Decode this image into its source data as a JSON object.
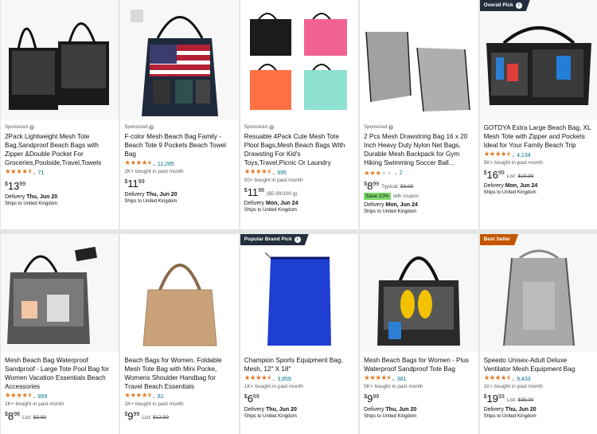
{
  "colors": {
    "overall_pick": "#232f3e",
    "brand_pick": "#232f3e",
    "best_seller": "#c45500",
    "star": "#de7921",
    "link": "#007185",
    "save": "#7fda69"
  },
  "products": [
    {
      "sponsored": "Sponsored",
      "title": "2Pack Lightweight Mesh Tote Bag,Sandproof Beach Bags with Zipper &Double Pocket For Groceries,Poolside,Travel,Towels",
      "rating": 4.5,
      "count": "71",
      "bought": "",
      "cur": "$",
      "whole": "13",
      "frac": "99",
      "delivery_pre": "Delivery ",
      "delivery_date": "Thu, Jun 20",
      "ships": "Ships to United Kingdom",
      "image": "tote-pair-black"
    },
    {
      "sponsored": "Sponsored",
      "title": "F-color Mesh Beach Bag Family - Beach Tote 9 Pockets Beach Towel Bag",
      "rating": 4.5,
      "count": "11,285",
      "bought": "2K+ bought in past month",
      "cur": "$",
      "whole": "11",
      "frac": "99",
      "delivery_pre": "Delivery ",
      "delivery_date": "Thu, Jun 20",
      "ships": "Ships to United Kingdom",
      "image": "flag-tote"
    },
    {
      "sponsored": "Sponsored",
      "title": "Resuable 4Pack Cute Mesh Tote Plool Bags,Mesh Beach Bags With Drawsting For Kid's Toys,Travel,Picnic Or Laundry",
      "rating": 4.5,
      "count": "695",
      "bought": "50+ bought in past month",
      "cur": "$",
      "whole": "11",
      "frac": "98",
      "unit": "($5.99/100 g)",
      "delivery_pre": "Delivery ",
      "delivery_date": "Mon, Jun 24",
      "ships": "Ships to United Kingdom",
      "image": "four-pack"
    },
    {
      "sponsored": "Sponsored",
      "title": "2 Pcs Mesh Drawstring Bag 16 x 20 Inch Heavy Duty Nylon Net Bags, Durable Mesh Backpack for Gym Hiking Swimming Soccer Ball...",
      "rating": 3.0,
      "count": "2",
      "bought": "",
      "cur": "$",
      "whole": "8",
      "frac": "99",
      "typical_label": "Typical: ",
      "typical_price": "$9.99",
      "save": "Save 10%",
      "coupon": "with coupon",
      "delivery_pre": "Delivery ",
      "delivery_date": "Mon, Jun 24",
      "ships": "Ships to United Kingdom",
      "image": "drawstring-pair"
    },
    {
      "badge": "Overall Pick",
      "title": "GOTDYA Extra Large Beach Bag, XL Mesh Tote with Zipper and Pockets Ideal for Your Family Beach Trip",
      "rating": 4.5,
      "count": "4,134",
      "bought": "5K+ bought in past month",
      "cur": "$",
      "whole": "16",
      "frac": "99",
      "list_label": "List: ",
      "list_price": "$19.99",
      "delivery_pre": "Delivery ",
      "delivery_date": "Mon, Jun 24",
      "ships": "Ships to United Kingdom",
      "image": "xl-tote"
    },
    {
      "title": "Mesh Beach Bag Waterproof Sandproof - Large Tote Pool Bag for Women Vacation Essentials Beach Accessories",
      "rating": 4.5,
      "count": "899",
      "bought": "2K+ bought in past month",
      "cur": "$",
      "whole": "8",
      "frac": "98",
      "list_label": "List: ",
      "list_price": "$9.99",
      "image": "grey-tote"
    },
    {
      "title": "Beach Bags for Women, Foldable Mesh Tote Bag with Mini Pocke, Womens Shoulder Handbag for Travel Beach Essentials",
      "rating": 4.5,
      "count": "81",
      "bought": "1K+ bought in past month",
      "cur": "$",
      "whole": "9",
      "frac": "99",
      "list_label": "List: ",
      "list_price": "$12.99",
      "image": "tan-tote"
    },
    {
      "badge": "Popular Brand Pick",
      "title": "Champion Sports Equipment Bag, Mesh, 12\" X 18\"",
      "rating": 4.5,
      "count": "3,859",
      "bought": "1K+ bought in past month",
      "cur": "$",
      "whole": "6",
      "frac": "99",
      "delivery_pre": "Delivery ",
      "delivery_date": "Thu, Jun 20",
      "ships": "Ships to United Kingdom",
      "image": "blue-net"
    },
    {
      "title": "Mesh Beach Bags for Women - Plus Waterproof Sandproof Tote Bag",
      "rating": 4.5,
      "count": "381",
      "bought": "5K+ bought in past month",
      "cur": "$",
      "whole": "9",
      "frac": "99",
      "delivery_pre": "Delivery ",
      "delivery_date": "Thu, Jun 20",
      "ships": "Ships to United Kingdom",
      "image": "black-tote"
    },
    {
      "badge": "Best Seller",
      "title": "Speedo Unisex-Adult Deluxe Ventilator Mesh Equipment Bag",
      "rating": 4.5,
      "count": "9,433",
      "bought": "1K+ bought in past month",
      "cur": "$",
      "whole": "19",
      "frac": "93",
      "list_label": "List: ",
      "list_price": "$35.00",
      "delivery_pre": "Delivery ",
      "delivery_date": "Thu, Jun 20",
      "ships": "Ships to United Kingdom",
      "image": "grey-backpack"
    }
  ]
}
